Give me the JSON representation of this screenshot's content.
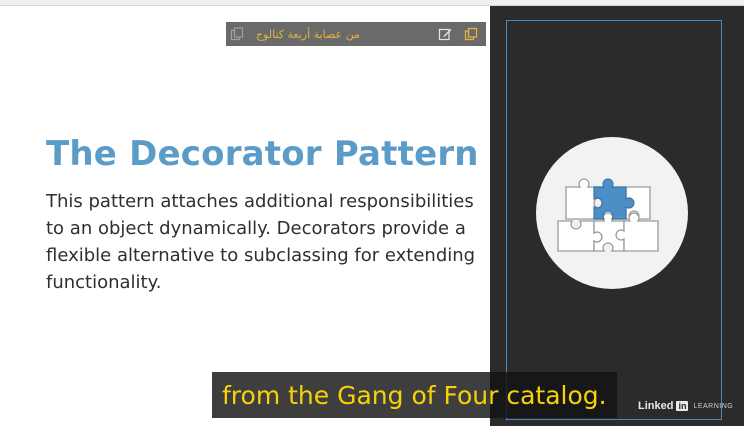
{
  "slide": {
    "title": "The Decorator Pattern",
    "description": "This pattern attaches additional responsibilities to an object dynamically. Decorators provide a flexible alternative to subclassing for extending functionality."
  },
  "toolbar": {
    "text": "من عصابة أربعة كتالوج",
    "icons": [
      "copy-icon",
      "edit-icon",
      "duplicate-icon"
    ],
    "accent": "#e0b43c"
  },
  "subtitle": {
    "text": "from the Gang of Four catalog."
  },
  "brand": {
    "word": "Linked",
    "in": "in",
    "learning": "LEARNING"
  },
  "colors": {
    "title": "#5b9bc7",
    "panel": "#2b2b2b",
    "frame": "#4a89c2",
    "caption_text": "#f5d20a"
  }
}
